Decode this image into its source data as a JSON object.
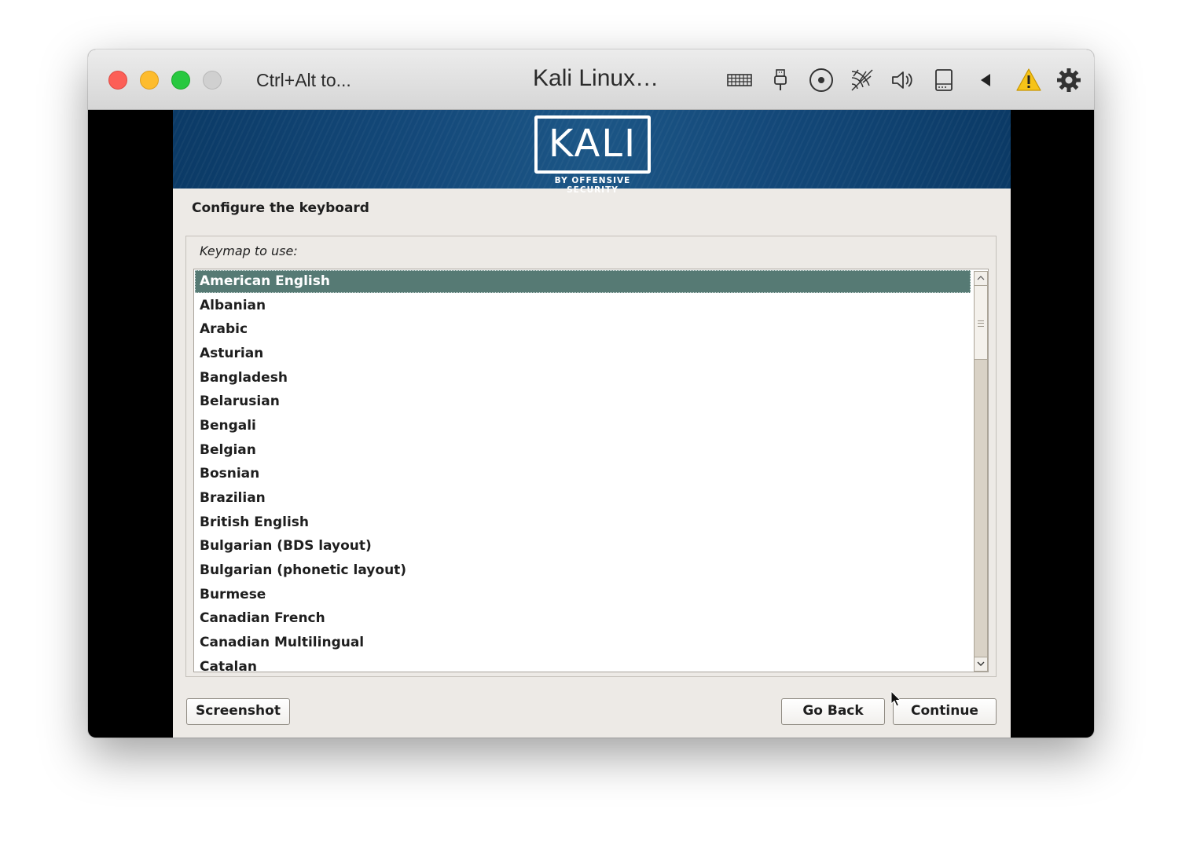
{
  "titlebar": {
    "hint": "Ctrl+Alt to...",
    "title": "Kali Linux…",
    "icons": [
      "keyboard-icon",
      "usb-icon",
      "optical-disc-icon",
      "network-icon",
      "audio-icon",
      "storage-icon",
      "back-arrow-icon",
      "warning-icon",
      "gear-icon"
    ]
  },
  "banner": {
    "logo": "KALI",
    "subtitle": "BY OFFENSIVE SECURITY"
  },
  "installer": {
    "title": "Configure the keyboard",
    "prompt": "Keymap to use:",
    "selected_index": 0,
    "keymaps": [
      "American English",
      "Albanian",
      "Arabic",
      "Asturian",
      "Bangladesh",
      "Belarusian",
      "Bengali",
      "Belgian",
      "Bosnian",
      "Brazilian",
      "British English",
      "Bulgarian (BDS layout)",
      "Bulgarian (phonetic layout)",
      "Burmese",
      "Canadian French",
      "Canadian Multilingual",
      "Catalan"
    ]
  },
  "buttons": {
    "screenshot": "Screenshot",
    "go_back": "Go Back",
    "continue": "Continue"
  },
  "colors": {
    "banner": "#0b3a66",
    "selection": "#567a74",
    "installer_bg": "#edeae6"
  }
}
